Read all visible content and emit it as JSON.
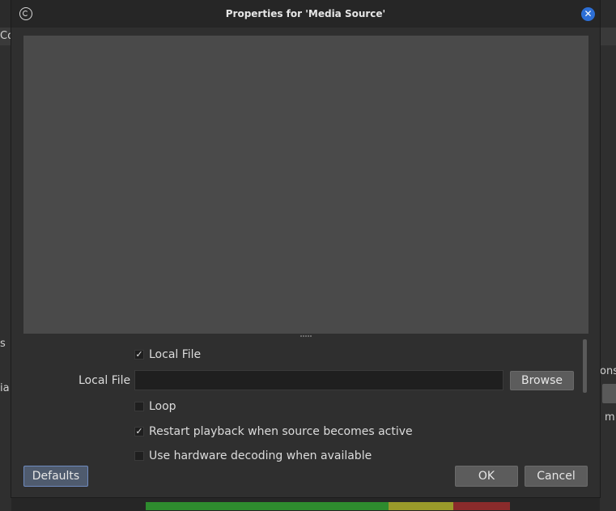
{
  "window": {
    "title": "Properties for 'Media Source'"
  },
  "background": {
    "frag_top_left": "Co",
    "frag_left_1": "s",
    "frag_left_2": "ia",
    "frag_right_1": "ons",
    "frag_right_2": "m"
  },
  "props": {
    "local_file_checkbox": {
      "label": "Local File",
      "checked": true,
      "mark": "✓"
    },
    "local_file_field": {
      "label": "Local File",
      "value": ""
    },
    "browse_label": "Browse",
    "loop_checkbox": {
      "label": "Loop",
      "checked": false,
      "mark": ""
    },
    "restart_checkbox": {
      "label": "Restart playback when source becomes active",
      "checked": true,
      "mark": "✓"
    },
    "hw_decode_checkbox": {
      "label": "Use hardware decoding when available",
      "checked": false,
      "mark": ""
    }
  },
  "footer": {
    "defaults_label": "Defaults",
    "ok_label": "OK",
    "cancel_label": "Cancel"
  },
  "colors": {
    "accent": "#2d6fd6",
    "dialog_bg": "#2f2f2f",
    "preview_bg": "#4a4a4a"
  },
  "icons": {
    "app": "obs-logo-icon",
    "close": "close-icon"
  }
}
